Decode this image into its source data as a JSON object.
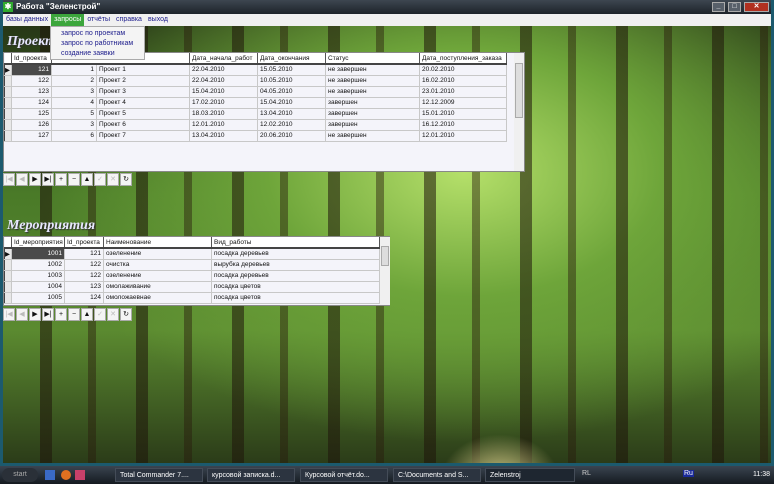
{
  "window": {
    "title": "Работа \"Зеленстрой\"",
    "min": "_",
    "max": "□",
    "close": "✕"
  },
  "menu": [
    "базы данных",
    "запросы",
    "отчёты",
    "справка",
    "выход"
  ],
  "dropdown": [
    "запрос по проектам",
    "запрос по работникам",
    "создание заявки"
  ],
  "projects": {
    "title": "Проекты",
    "columns": [
      "Id_проекта",
      "",
      "Дата_начала_работ",
      "Дата_окончания",
      "Статус",
      "Дата_поступления_заказа"
    ],
    "rows": [
      [
        "121",
        "1",
        "Проект 1",
        "22.04.2010",
        "15.05.2010",
        "не завершен",
        "20.02.2010"
      ],
      [
        "122",
        "2",
        "Проект 2",
        "22.04.2010",
        "10.05.2010",
        "не завершен",
        "16.02.2010"
      ],
      [
        "123",
        "3",
        "Проект 3",
        "15.04.2010",
        "04.05.2010",
        "не завершен",
        "23.01.2010"
      ],
      [
        "124",
        "4",
        "Проект 4",
        "17.02.2010",
        "15.04.2010",
        "завершен",
        "12.12.2009"
      ],
      [
        "125",
        "5",
        "Проект 5",
        "18.03.2010",
        "13.04.2010",
        "завершен",
        "15.01.2010"
      ],
      [
        "126",
        "3",
        "Проект 6",
        "12.01.2010",
        "12.02.2010",
        "завершен",
        "16.12.2010"
      ],
      [
        "127",
        "6",
        "Проект 7",
        "13.04.2010",
        "20.06.2010",
        "не завершен",
        "12.01.2010"
      ]
    ]
  },
  "events": {
    "title": "Мероприятия",
    "columns": [
      "Id_мероприятия",
      "Id_проекта",
      "Наименование",
      "Вид_работы"
    ],
    "rows": [
      [
        "1001",
        "121",
        "озеленение",
        "посадка деревьев"
      ],
      [
        "1002",
        "122",
        "очистка",
        "вырубка деревьев"
      ],
      [
        "1003",
        "122",
        "озеленение",
        "посадка деревьев"
      ],
      [
        "1004",
        "123",
        "омолаживание",
        "посадка цветов"
      ],
      [
        "1005",
        "124",
        "омоложаевнае",
        "посадка цветов"
      ]
    ]
  },
  "navigator": [
    "|◀",
    "◀",
    "▶",
    "▶|",
    "+",
    "−",
    "▲",
    "✓",
    "✕",
    "↻"
  ],
  "taskbar": {
    "start": "start",
    "items": [
      "Total Commander 7....",
      "курсовой записка.d...",
      "Курсовой отчёт.do...",
      "C:\\Documents and S...",
      "Zelenstroj"
    ],
    "lang": "RL",
    "tray_lang": "Ru",
    "time": "11:38"
  }
}
